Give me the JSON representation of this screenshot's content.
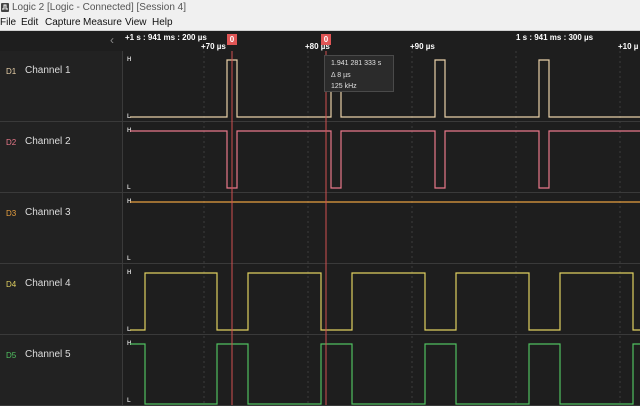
{
  "window": {
    "title": "Logic 2 [Logic - Connected] [Session 4]"
  },
  "menu": [
    "File",
    "Edit",
    "Capture",
    "Measure",
    "View",
    "Help"
  ],
  "ruler": {
    "start_label": "+1 s : 941 ms : 200 µs",
    "ticks": [
      "+70 µs",
      "+80 µs",
      "+90 µs",
      "+10 µ"
    ],
    "mid_label": "1 s : 941 ms : 300 µs",
    "marker_a": "0",
    "marker_b": "0"
  },
  "channels": [
    {
      "id": "D1",
      "name": "Channel 1",
      "color": "#e8d0a8",
      "high_label": "H",
      "low_label": "L"
    },
    {
      "id": "D2",
      "name": "Channel 2",
      "color": "#e8788a",
      "high_label": "H",
      "low_label": "L"
    },
    {
      "id": "D3",
      "name": "Channel 3",
      "color": "#e8a040",
      "high_label": "H",
      "low_label": "L"
    },
    {
      "id": "D4",
      "name": "Channel 4",
      "color": "#e0d060",
      "high_label": "H",
      "low_label": "L"
    },
    {
      "id": "D5",
      "name": "Channel 5",
      "color": "#50c060",
      "high_label": "H",
      "low_label": "L"
    }
  ],
  "tooltip": {
    "time": "1.941 281 333 s",
    "delta": "Δ 8 µs",
    "freq": "125 kHz"
  }
}
